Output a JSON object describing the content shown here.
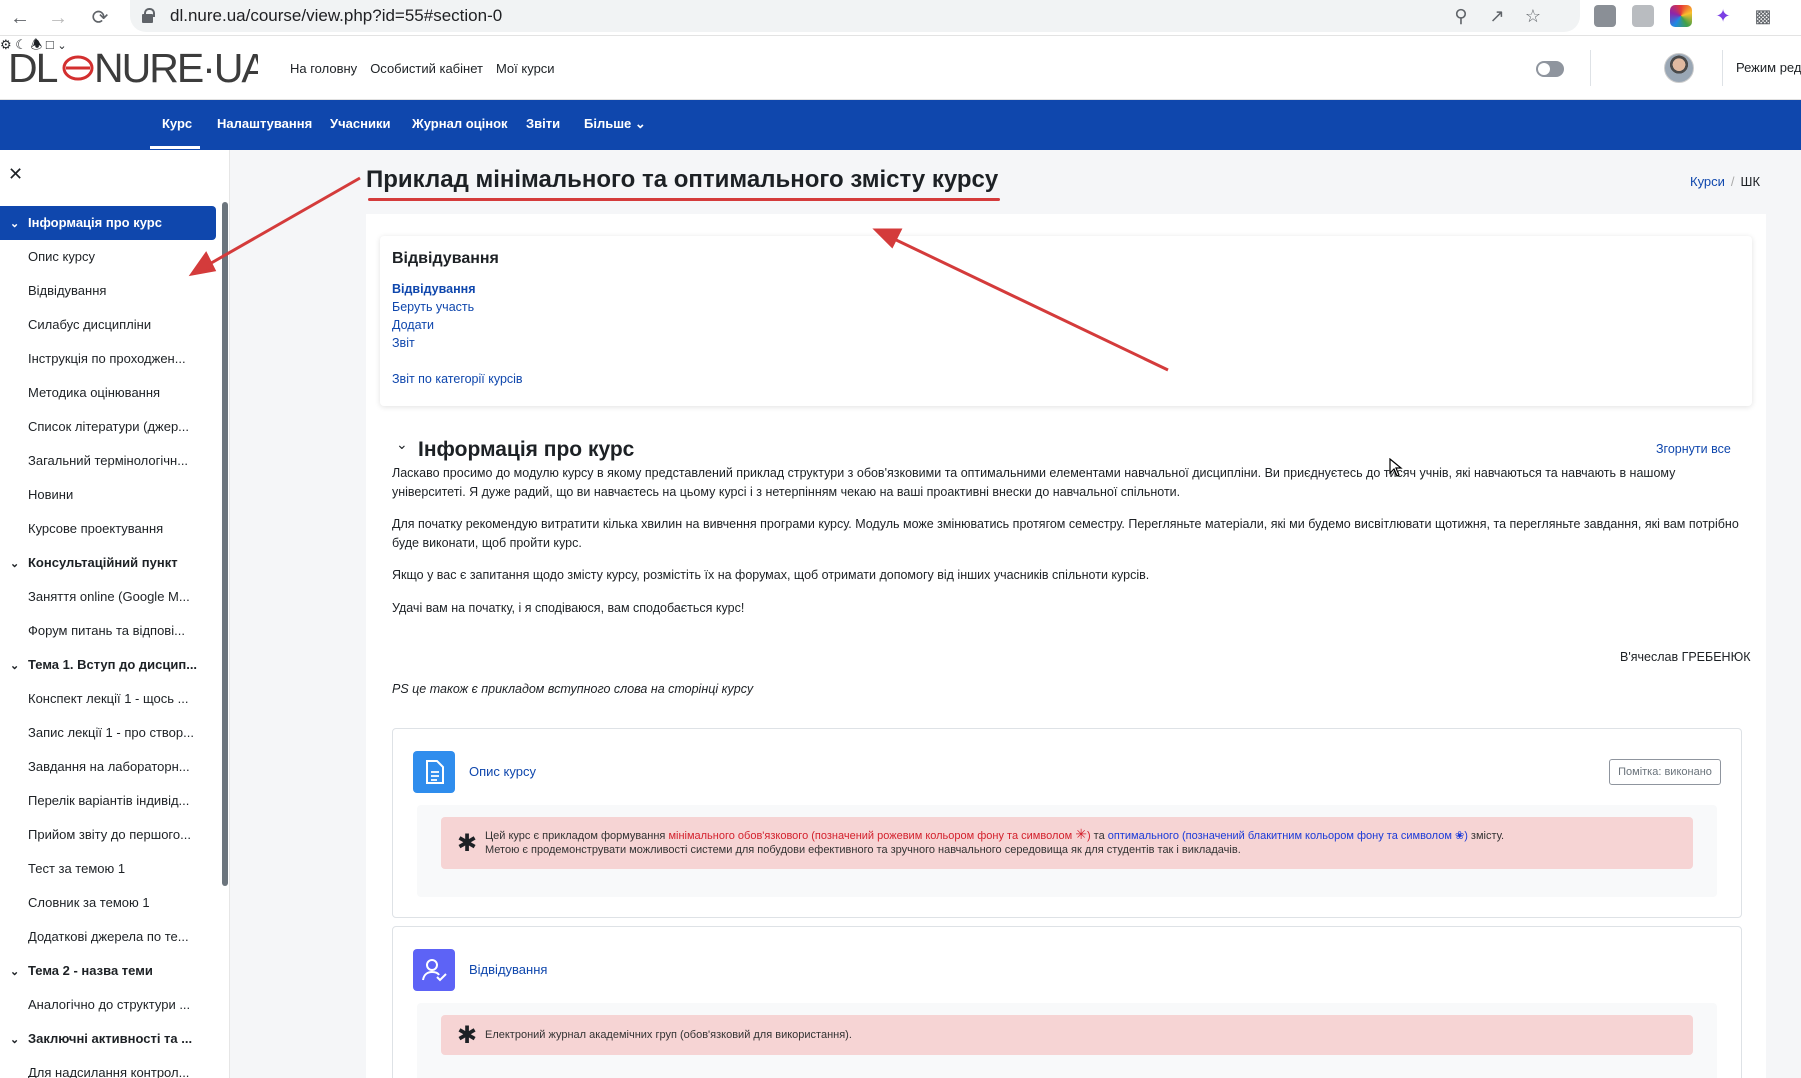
{
  "browser": {
    "url": "dl.nure.ua/course/view.php?id=55#section-0"
  },
  "site": {
    "logo_text": "DL⦾NURE·UA",
    "nav": [
      "На головну",
      "Особистий кабінет",
      "Мої курси"
    ],
    "edit_mode": "Режим ред"
  },
  "secondary_nav": [
    "Курс",
    "Налаштування",
    "Учасники",
    "Журнал оцінок",
    "Звіти",
    "Більше ⌄"
  ],
  "drawer": {
    "items": [
      {
        "type": "section",
        "label": "Інформація про курс",
        "current": true
      },
      {
        "type": "activity",
        "label": "Опис курсу"
      },
      {
        "type": "activity",
        "label": "Відвідування"
      },
      {
        "type": "activity",
        "label": "Силабус дисципліни"
      },
      {
        "type": "activity",
        "label": "Інструкція по проходжен..."
      },
      {
        "type": "activity",
        "label": "Методика оцінювання"
      },
      {
        "type": "activity",
        "label": "Список літератури (джер..."
      },
      {
        "type": "activity",
        "label": "Загальний термінологічн..."
      },
      {
        "type": "activity",
        "label": "Новини"
      },
      {
        "type": "activity",
        "label": "Курсове проектування"
      },
      {
        "type": "section",
        "label": "Консультаційний пункт"
      },
      {
        "type": "activity",
        "label": "Заняття online (Google M..."
      },
      {
        "type": "activity",
        "label": "Форум питань та відпові..."
      },
      {
        "type": "section",
        "label": "Тема 1. Вступ до дисцип..."
      },
      {
        "type": "activity",
        "label": "Конспект лекції 1 - щось ..."
      },
      {
        "type": "activity",
        "label": "Запис лекції 1 - про створ..."
      },
      {
        "type": "activity",
        "label": "Завдання на лабораторн..."
      },
      {
        "type": "activity",
        "label": "Перелік варіантів індивід..."
      },
      {
        "type": "activity",
        "label": "Прийом звіту до першого..."
      },
      {
        "type": "activity",
        "label": "Тест за темою 1"
      },
      {
        "type": "activity",
        "label": "Словник за темою 1"
      },
      {
        "type": "activity",
        "label": "Додаткові джерела по те..."
      },
      {
        "type": "section",
        "label": "Тема 2 - назва теми"
      },
      {
        "type": "activity",
        "label": "Аналогічно до структури ..."
      },
      {
        "type": "section",
        "label": "Заключні активності та ..."
      },
      {
        "type": "activity",
        "label": "Для надсилання контрол..."
      }
    ]
  },
  "page": {
    "title": "Приклад мінімального та оптимального змісту курсу",
    "breadcrumb": {
      "link": "Курси",
      "current": "ШК"
    }
  },
  "attendance_block": {
    "title": "Відвідування",
    "links": [
      "Відвідування",
      "Беруть участь",
      "Додати",
      "Звіт"
    ],
    "category_report": "Звіт по категорії курсів"
  },
  "section": {
    "title": "Інформація про курс",
    "collapse_all": "Згорнути все",
    "paragraphs": [
      "Ласкаво просимо до модулю курсу в якому представлений приклад структури з обов'язковими та оптимальними елементами навчальної дисципліни. Ви приєднуєтесь до тисяч учнів, які навчаються та навчають в нашому університеті. Я дуже радий, що ви навчаєтесь на цьому курсі і з нетерпінням чекаю на ваші проактивні внески до навчальної спільноти.",
      "Для початку рекомендую витратити кілька хвилин на вивчення програми курсу. Модуль може змінюватись протягом семестру. Перегляньте матеріали, які ми будемо висвітлювати щотижня, та перегляньте завдання, які вам потрібно буде виконати, щоб пройти курс.",
      "Якщо у вас є запитання щодо змісту курсу, розмістіть їх на форумах, щоб отримати допомогу від інших учасників спільноти курсів.",
      "Удачі вам на початку, і я сподіваюся, вам сподобається курс!"
    ],
    "signature": "В'ячеслав ГРЕБЕНЮК",
    "ps": "PS це також є прикладом вступного слова на сторінці курсу"
  },
  "activities": [
    {
      "title": "Опис курсу",
      "mark_button": "Помітка: виконано",
      "note_parts": {
        "a": "Цей курс є прикладом формування ",
        "b": "мінімального обов'язкового (позначений рожевим кольором фону та символом ",
        "c": "✳",
        "d": ")",
        "e": " та ",
        "f": "оптимального (позначений блакитним кольором фону та символом ",
        "g": "❀",
        "h": ")",
        "i": " змісту.",
        "line2": "Метою є продемонструвати можливості системи для побудови ефективного та зручного навчального середовища як для студентів так і викладачів."
      }
    },
    {
      "title": "Відвідування",
      "note": "Електроний журнал академічних груп (обов'язковий для використання)."
    }
  ],
  "colors": {
    "brand_blue": "#0f47ad",
    "required_pink": "#f6d4d4",
    "annotation_red": "#d43b3b"
  }
}
